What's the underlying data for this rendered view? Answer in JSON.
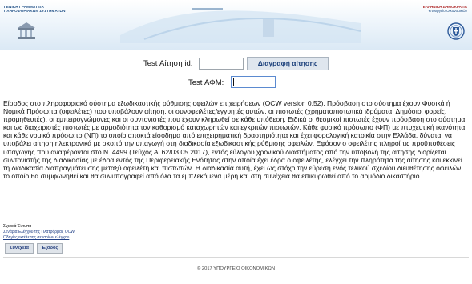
{
  "header": {
    "org_left_line1": "ΓΕΝΙΚΗ ΓΡΑΜΜΑΤΕΙΑ",
    "org_left_line2": "ΠΛΗΡΟΦΟΡΙΑΚΩΝ ΣΥΣΤΗΜΑΤΩΝ",
    "org_right_line1": "ΕΛΛΗΝΙΚΗ ΔΗΜΟΚΡΑΤΙΑ",
    "org_right_line2": "Υπουργείο Οικονομικών"
  },
  "form": {
    "test_request_id_label": "Test Αίτηση id:",
    "test_request_id_value": "",
    "delete_request_button": "Διαγραφή αίτησης",
    "test_afm_label": "Test ΑΦΜ:",
    "test_afm_value": ""
  },
  "description": "Είσοδος στο πληροφοριακό σύστημα εξωδικαστικής ρύθμισης οφειλών επιχειρήσεων (OCW version 0.52). Πρόσβαση στο σύστημα έχουν Φυσικά ή Νομικά Πρόσωπα (οφειλέτες) που υποβάλουν αίτηση, οι συνοφειλέτες/εγγυητές αυτών, οι πιστωτές (χρηματοπιστωτικά ιδρύματα, Δημόσιοι φορείς, προμηθευτές), οι εμπειρογνώμονες και οι συντονιστές που έχουν κληρωθεί σε κάθε υπόθεση. Ειδικά οι θεσμικοί πιστωτές έχουν πρόσβαση στο σύστημα και ως διαχειριστές πιστωτές με αρμοδιότητα τον καθορισμό καταχωρητών και εγκριτών πιστωτών. Κάθε φυσικό πρόσωπο (ΦΠ) με πτυχευτική ικανότητα και κάθε νομικό πρόσωπο (ΝΠ) το οποίο αποκτά είσοδημα από επιχειρηματική δραστηριότητα και έχει φορολογική κατοικία στην Ελλάδα, δύναται να υποβάλει αίτηση ηλεκτρονικά με σκοπό την υπαγωγή στη διαδικασία εξωδικαστικής ρύθμισης οφειλών. Εφόσον ο οφειλέτης πληροί τις προϋποθέσεις υπαγωγής που αναφέρονται στο Ν. 4499 (Τεύχος Α' 62/03.05.2017), εντός εύλογου χρονικού διαστήματος από την υποβολή της αίτησης διορίζεται συντονιστής της διαδικασίας με έδρα εντός της Περιφερειακής Ενότητας στην οποία έχει έδρα ο οφειλέτης, ελέγχει την πληρότητα της αίτησης και εκκινεί τη διαδικασία διαπραγμάτευσης μεταξύ οφειλέτη και πιστωτών. Η διαδικασία αυτή, έχει ως στόχο την εύρεση ενός τελικού σχεδίου διευθέτησης οφειλών, το οποίο θα συμφωνηθεί και θα συνυπογραφεί από όλα τα εμπλεκόμενα μέρη και στη συνέχεια θα επικυρωθεί από το αρμόδιο δικαστήριο.",
  "links": {
    "related_title": "Σχετικά Έντυπα",
    "link1": "Σενάρια Ελέγχου της Πλατφόρμας OCW",
    "link2": "Οδηγίες εκτέλεσης σεναρίων ελέγχου"
  },
  "buttons": {
    "continue": "Συνέχεια",
    "exit": "Έξοδος"
  },
  "footer": "© 2017 ΥΠΟΥΡΓΕΙΟ ΟΙΚΟΝΟΜΙΚΩΝ"
}
